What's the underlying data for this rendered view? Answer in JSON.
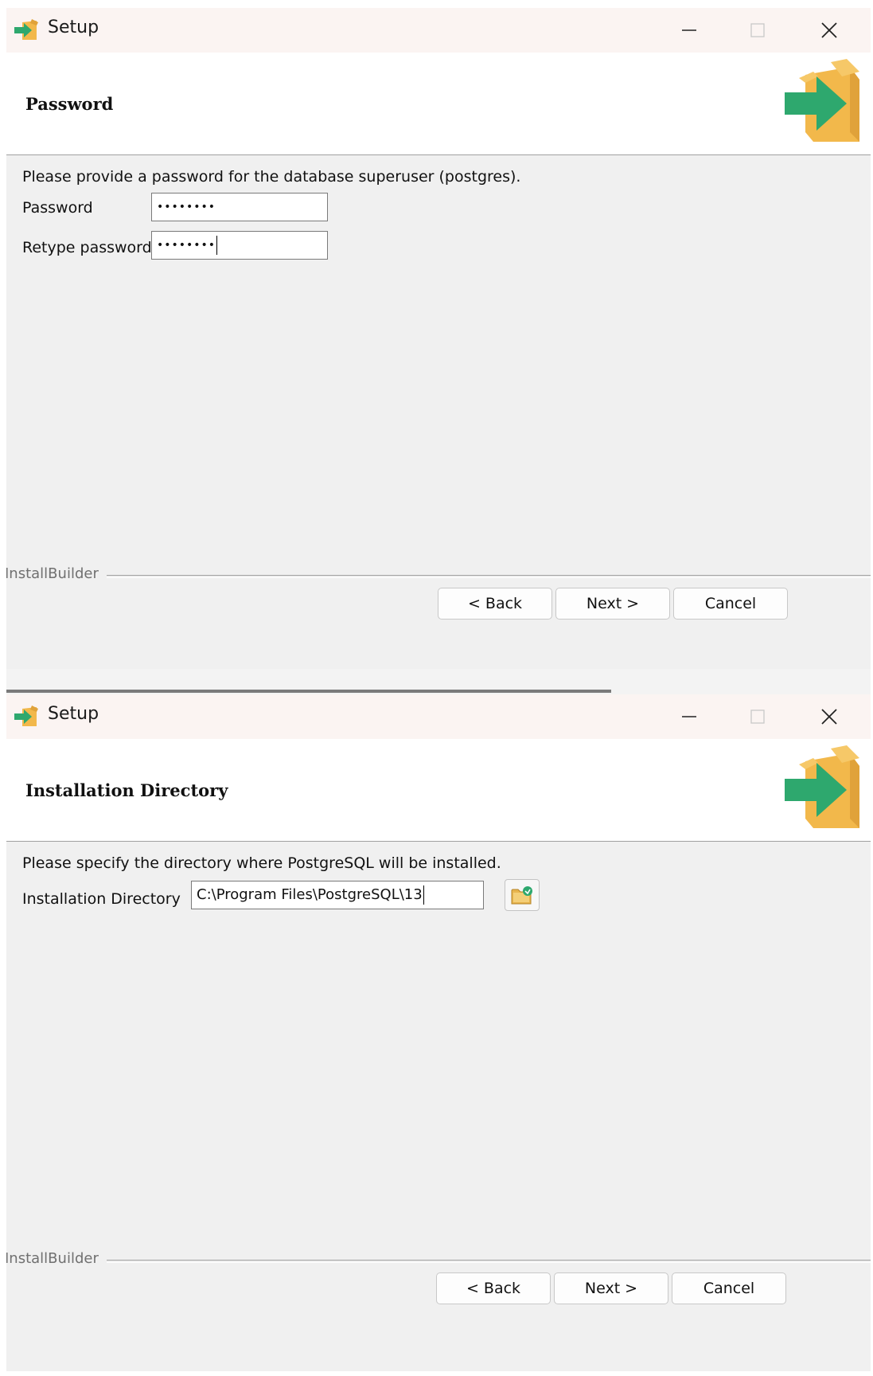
{
  "windows": [
    {
      "title": "Setup",
      "header_title": "Password",
      "instruction": "Please provide a password for the database superuser (postgres).",
      "fields": [
        {
          "label": "Password",
          "value": "••••••••"
        },
        {
          "label": "Retype password",
          "value": "••••••••"
        }
      ],
      "footer_brand": "InstallBuilder",
      "buttons": {
        "back": "< Back",
        "next": "Next >",
        "cancel": "Cancel"
      }
    },
    {
      "title": "Setup",
      "header_title": "Installation Directory",
      "instruction": "Please specify the directory where PostgreSQL will be installed.",
      "fields": [
        {
          "label": "Installation Directory",
          "value": "C:\\Program Files\\PostgreSQL\\13"
        }
      ],
      "footer_brand": "InstallBuilder",
      "buttons": {
        "back": "< Back",
        "next": "Next >",
        "cancel": "Cancel"
      }
    }
  ],
  "icons": {
    "app": "installer-arrow-box-icon",
    "minimize": "minimize-icon",
    "maximize": "maximize-icon",
    "close": "close-icon",
    "browse": "folder-browse-icon"
  },
  "colors": {
    "box": "#f2b84b",
    "box_dark": "#e0a23a",
    "arrow": "#2ea86e",
    "window_bg": "#f0f0f0",
    "title_bg": "#fbf4f2"
  }
}
